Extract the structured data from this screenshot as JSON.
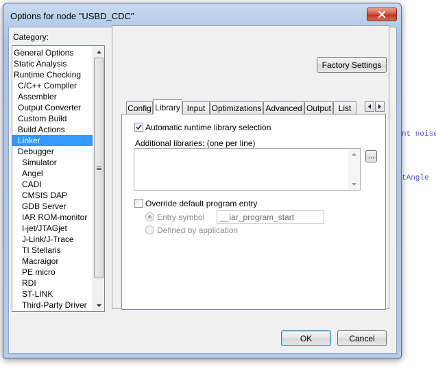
{
  "background": {
    "code_right_1": "nt noise",
    "code_right_2": "tAngle"
  },
  "dialog": {
    "title": "Options for node \"USBD_CDC\"",
    "close_label": "✕"
  },
  "category": {
    "label": "Category:",
    "items": [
      {
        "label": "General Options",
        "indent": 0
      },
      {
        "label": "Static Analysis",
        "indent": 0
      },
      {
        "label": "Runtime Checking",
        "indent": 0
      },
      {
        "label": "C/C++ Compiler",
        "indent": 1
      },
      {
        "label": "Assembler",
        "indent": 1
      },
      {
        "label": "Output Converter",
        "indent": 1
      },
      {
        "label": "Custom Build",
        "indent": 1
      },
      {
        "label": "Build Actions",
        "indent": 1
      },
      {
        "label": "Linker",
        "indent": 1,
        "selected": true
      },
      {
        "label": "Debugger",
        "indent": 1
      },
      {
        "label": "Simulator",
        "indent": 2
      },
      {
        "label": "Angel",
        "indent": 2
      },
      {
        "label": "CADI",
        "indent": 2
      },
      {
        "label": "CMSIS DAP",
        "indent": 2
      },
      {
        "label": "GDB Server",
        "indent": 2
      },
      {
        "label": "IAR ROM-monitor",
        "indent": 2
      },
      {
        "label": "I-jet/JTAGjet",
        "indent": 2
      },
      {
        "label": "J-Link/J-Trace",
        "indent": 2
      },
      {
        "label": "TI Stellaris",
        "indent": 2
      },
      {
        "label": "Macraigor",
        "indent": 2
      },
      {
        "label": "PE micro",
        "indent": 2
      },
      {
        "label": "RDI",
        "indent": 2
      },
      {
        "label": "ST-LINK",
        "indent": 2
      },
      {
        "label": "Third-Party Driver",
        "indent": 2
      }
    ]
  },
  "factory_settings_label": "Factory Settings",
  "tabs": [
    {
      "label": "Config"
    },
    {
      "label": "Library",
      "active": true
    },
    {
      "label": "Input"
    },
    {
      "label": "Optimizations"
    },
    {
      "label": "Advanced"
    },
    {
      "label": "Output"
    },
    {
      "label": "List"
    }
  ],
  "library": {
    "auto_runtime_label": "Automatic runtime library selection",
    "auto_runtime_checked": true,
    "additional_libraries_label": "Additional libraries: (one per line)",
    "browse_label": "...",
    "override_entry_label": "Override default program entry",
    "override_entry_checked": false,
    "entry_symbol_label": "Entry symbol",
    "entry_symbol_value": "__iar_program_start",
    "defined_by_app_label": "Defined by application"
  },
  "buttons": {
    "ok": "OK",
    "cancel": "Cancel"
  },
  "colors": {
    "selection": "#3399ff",
    "close_button": "#c0321c"
  }
}
